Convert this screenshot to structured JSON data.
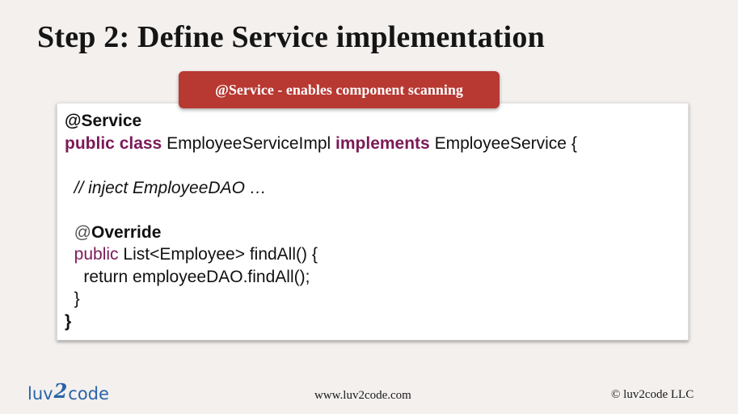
{
  "slide": {
    "title": "Step 2: Define Service implementation",
    "badge": "@Service - enables component scanning"
  },
  "code": {
    "line1_annotation": "@Service",
    "line2_kw1": "public",
    "line2_kw2": "class",
    "line2_name": "EmployeeServiceImpl",
    "line2_kw3": "implements",
    "line2_iface": "EmployeeService {",
    "line4_comment": "// inject EmployeeDAO …",
    "line6_at": "@",
    "line6_override": "Override",
    "line7_kw": "public",
    "line7_rest": "List<Employee> findAll() {",
    "line8": "return employeeDAO.findAll();",
    "line9": "}",
    "line10": "}"
  },
  "footer": {
    "logo_left": "luv",
    "logo_mid": "2",
    "logo_right": "code",
    "url": "www.luv2code.com",
    "copyright": "© luv2code LLC"
  },
  "colors": {
    "badge": "#b83832",
    "keyword": "#7b1a57",
    "logo": "#2b63a8",
    "background": "#f3f0ee"
  }
}
